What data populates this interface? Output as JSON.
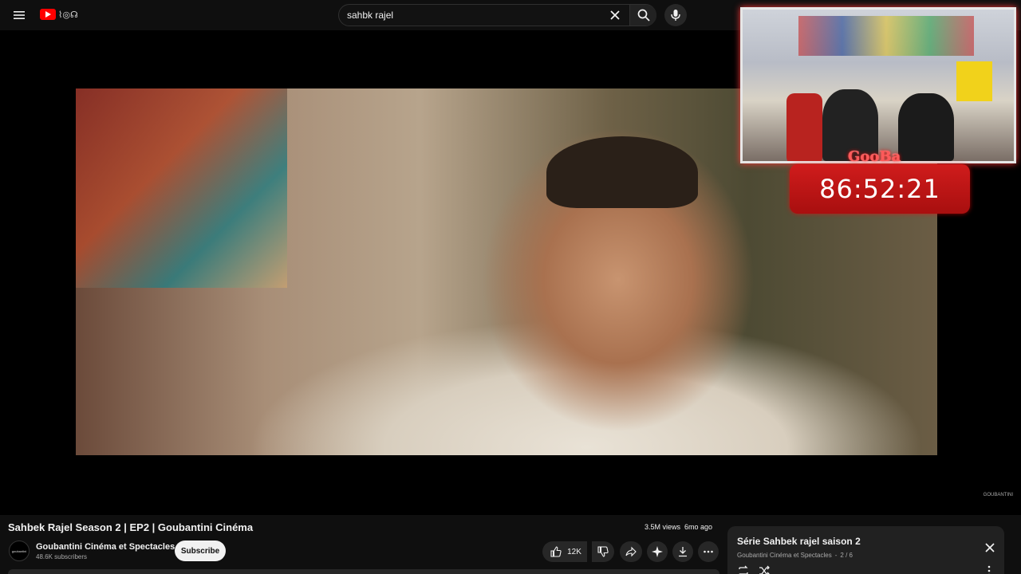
{
  "search": {
    "query": "sahbk rajel"
  },
  "overlay": {
    "timer": "86:52:21",
    "label": "GooBa"
  },
  "video": {
    "title": "Sahbek Rajel Season 2 | EP2 | Goubantini Cinéma",
    "views": "3.5M views",
    "age": "6mo ago",
    "watermark": "GOUBANTINI"
  },
  "channel": {
    "name": "Goubantini Cinéma et Spectacles",
    "subscribers": "48.6K subscribers",
    "subscribe_label": "Subscribe",
    "avatar_text": "goubantini"
  },
  "actions": {
    "like_count": "12K"
  },
  "playlist": {
    "title": "Série Sahbek rajel saison 2",
    "owner": "Goubantini Cinéma et Spectacles",
    "position": "2 / 6",
    "separator": "-"
  },
  "colors": {
    "brand_red": "#ff0000",
    "background": "#0f0f0f",
    "timer_red": "#d01c1c"
  }
}
